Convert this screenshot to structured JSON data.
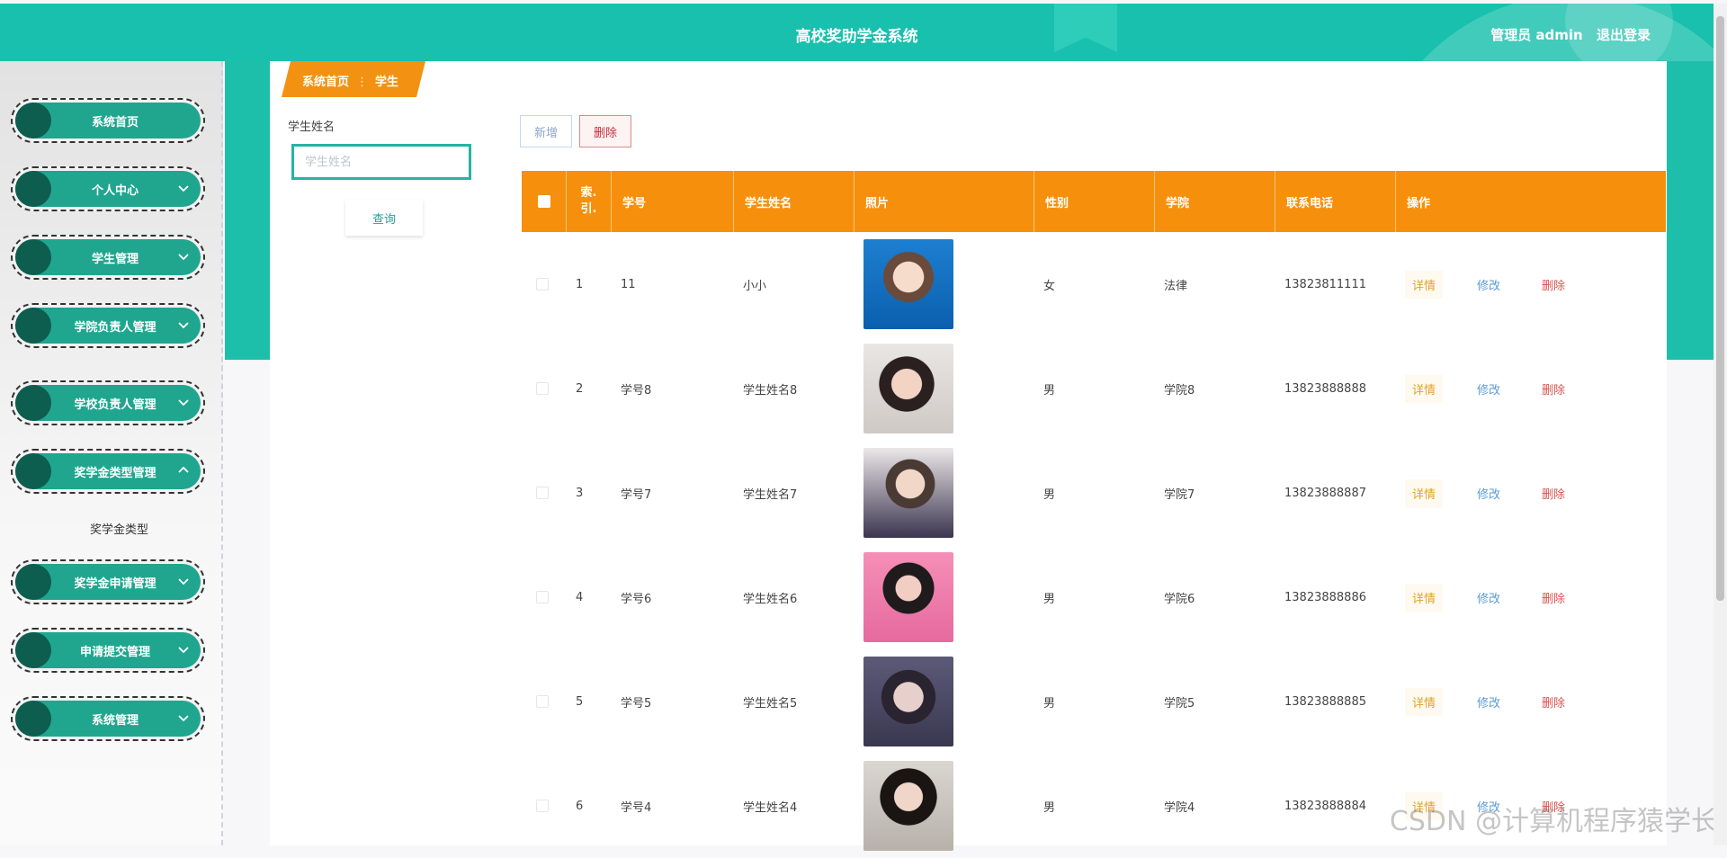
{
  "header": {
    "title": "高校奖助学金系统",
    "user_label": "管理员 admin",
    "logout_label": "退出登录"
  },
  "sidebar": {
    "items": [
      {
        "label": "系统首页",
        "has_chevron": false
      },
      {
        "label": "个人中心",
        "has_chevron": true
      },
      {
        "label": "学生管理",
        "has_chevron": true
      },
      {
        "label": "学院负责人管理",
        "has_chevron": true
      },
      {
        "label": "学校负责人管理",
        "has_chevron": true
      },
      {
        "label": "奖学金类型管理",
        "has_chevron": true,
        "expanded": true
      },
      {
        "label": "奖学金申请管理",
        "has_chevron": true
      },
      {
        "label": "申请提交管理",
        "has_chevron": true
      },
      {
        "label": "系统管理",
        "has_chevron": true
      }
    ],
    "submenu_label": "奖学金类型"
  },
  "breadcrumb": {
    "home": "系统首页",
    "separator": "⋮",
    "current": "学生"
  },
  "search": {
    "label": "学生姓名",
    "placeholder": "学生姓名",
    "query_label": "查询"
  },
  "toolbar": {
    "add_label": "新增",
    "delete_label": "删除"
  },
  "table": {
    "columns": [
      "索引",
      "学号",
      "学生姓名",
      "照片",
      "性别",
      "学院",
      "联系电话",
      "操作"
    ],
    "index_header_lines": [
      "索.",
      "引."
    ],
    "actions": {
      "detail": "详情",
      "edit": "修改",
      "delete": "删除"
    },
    "rows": [
      {
        "index": "1",
        "student_no": "11",
        "name": "小小",
        "photo": "student-photo-1",
        "gender": "女",
        "college": "法律",
        "phone": "13823811111"
      },
      {
        "index": "2",
        "student_no": "学号8",
        "name": "学生姓名8",
        "photo": "student-photo-2",
        "gender": "男",
        "college": "学院8",
        "phone": "13823888888"
      },
      {
        "index": "3",
        "student_no": "学号7",
        "name": "学生姓名7",
        "photo": "student-photo-3",
        "gender": "男",
        "college": "学院7",
        "phone": "13823888887"
      },
      {
        "index": "4",
        "student_no": "学号6",
        "name": "学生姓名6",
        "photo": "student-photo-4",
        "gender": "男",
        "college": "学院6",
        "phone": "13823888886"
      },
      {
        "index": "5",
        "student_no": "学号5",
        "name": "学生姓名5",
        "photo": "student-photo-5",
        "gender": "男",
        "college": "学院5",
        "phone": "13823888885"
      },
      {
        "index": "6",
        "student_no": "学号4",
        "name": "学生姓名4",
        "photo": "student-photo-6",
        "gender": "男",
        "college": "学院4",
        "phone": "13823888884"
      }
    ]
  },
  "watermark": "CSDN @计算机程序猿学长",
  "colors": {
    "header": "#18c0ad",
    "nav_pill": "#20a68f",
    "nav_dot": "#0d5e4f",
    "table_header": "#f6900c",
    "detail": "#e0a32a",
    "edit": "#5b9bd5",
    "delete": "#d9534f"
  }
}
